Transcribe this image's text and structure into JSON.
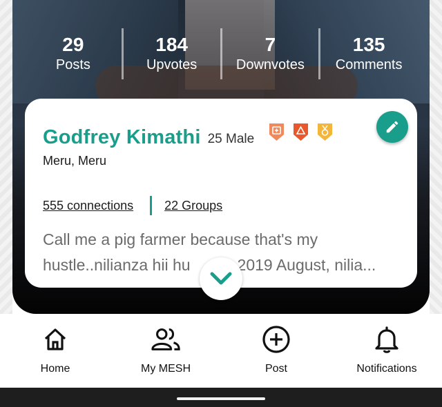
{
  "stats": [
    {
      "value": "29",
      "label": "Posts"
    },
    {
      "value": "184",
      "label": "Upvotes"
    },
    {
      "value": "7",
      "label": "Downvotes"
    },
    {
      "value": "135",
      "label": "Comments"
    }
  ],
  "profile": {
    "name": "Godfrey Kimathi",
    "meta": "25 Male",
    "location": "Meru, Meru",
    "connections": "555 connections",
    "groups": "22 Groups",
    "bio_line1": "Call me a pig farmer because that's my",
    "bio_line2": "hustle..nilianza hii hu",
    "bio_line2_end": "2019 August, nilia...",
    "badges": [
      "hospital-badge",
      "hazard-badge",
      "medal-badge"
    ]
  },
  "nav": {
    "home": "Home",
    "mesh": "My MESH",
    "post": "Post",
    "notifications": "Notifications"
  },
  "colors": {
    "accent": "#1a9e8c",
    "badge_orange": "#f08a5d",
    "badge_red": "#e8582c",
    "badge_gold": "#f3b63b"
  }
}
